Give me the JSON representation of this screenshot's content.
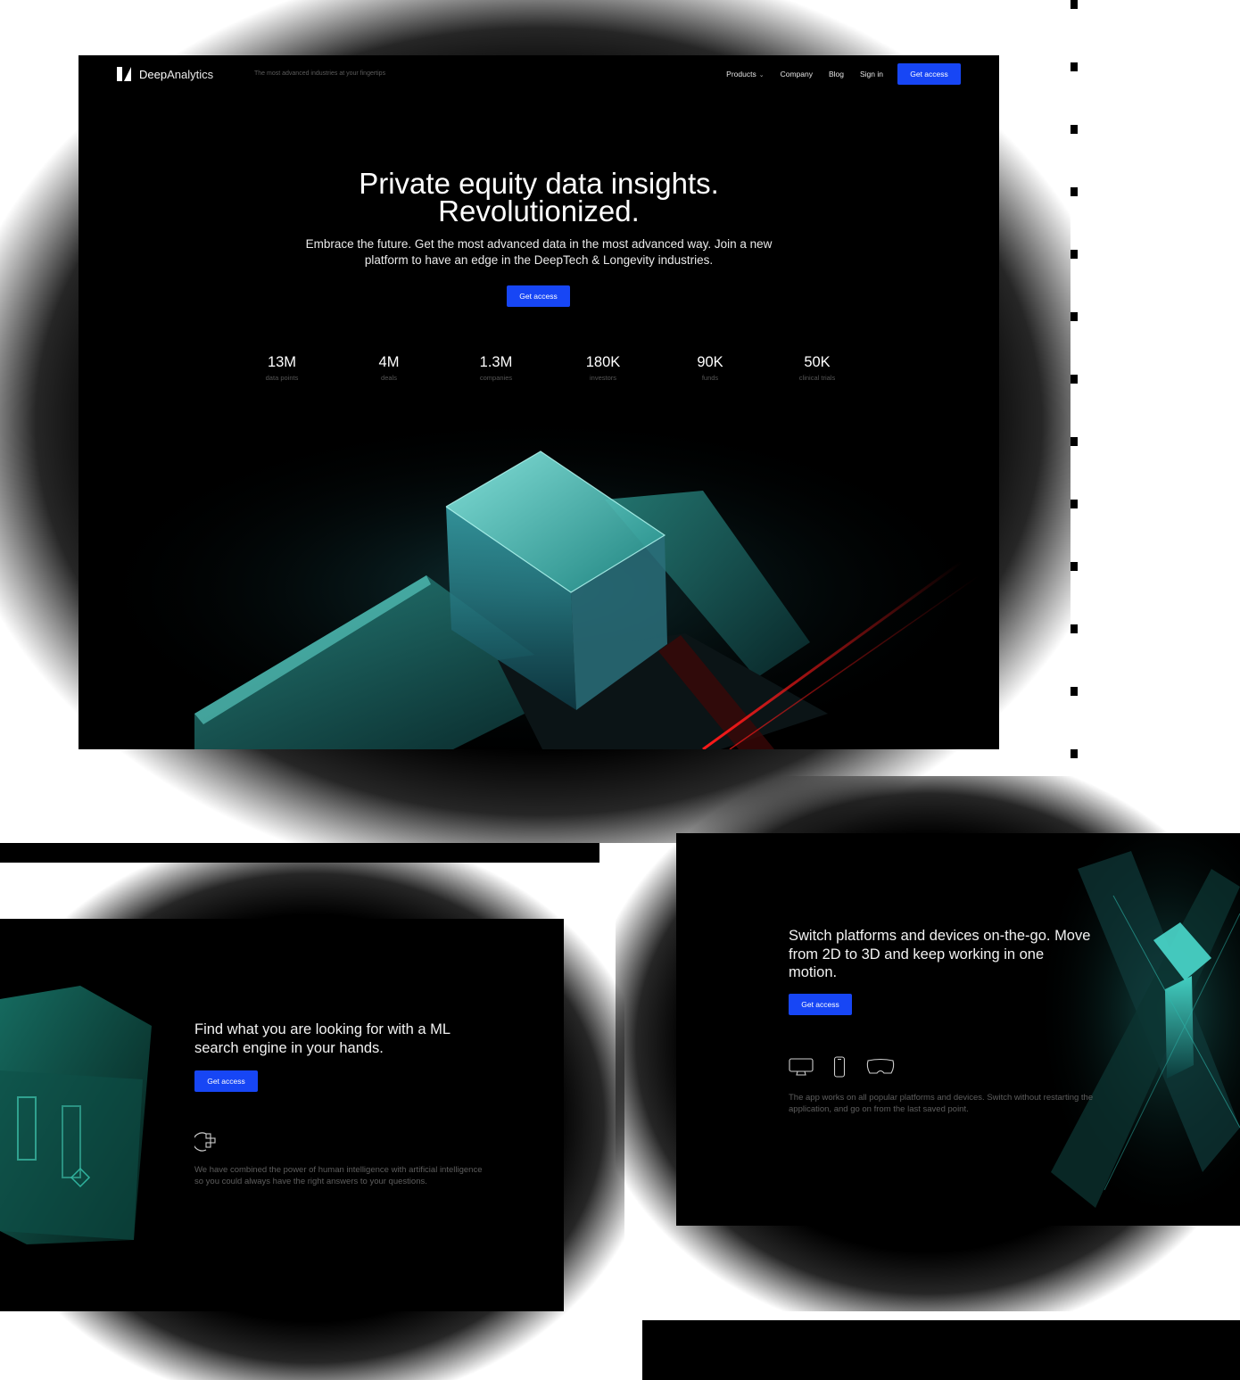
{
  "brand": {
    "name_bold": "Deep",
    "name_rest": "Analytics",
    "tagline": "The most advanced industries at your fingertips"
  },
  "nav": {
    "items": [
      "Products",
      "Company",
      "Blog",
      "Sign in"
    ],
    "cta": "Get access"
  },
  "hero": {
    "title_line1": "Private equity data insights.",
    "title_line2": "Revolutionized.",
    "subtitle": "Embrace the future. Get the most advanced data in the most advanced way. Join a new platform to have an edge in the DeepTech & Longevity industries.",
    "cta": "Get access"
  },
  "stats": [
    {
      "value": "13M",
      "label": "data points"
    },
    {
      "value": "4M",
      "label": "deals"
    },
    {
      "value": "1.3M",
      "label": "companies"
    },
    {
      "value": "180K",
      "label": "investors"
    },
    {
      "value": "90K",
      "label": "funds"
    },
    {
      "value": "50K",
      "label": "clinical trials"
    }
  ],
  "search_section": {
    "title": "Find what you are looking for with a ML search engine in your hands.",
    "cta": "Get access",
    "icon": "brain-circuit-icon",
    "description": "We have combined the power of human intelligence with artificial intelligence so you could always have the right answers to your questions."
  },
  "devices_section": {
    "title": "Switch platforms and devices on-the-go. Move from 2D to 3D and keep working in one motion.",
    "cta": "Get access",
    "icons": [
      "desktop-icon",
      "phone-icon",
      "vr-headset-icon"
    ],
    "description": "The app works on all popular platforms and devices. Switch without restarting the application, and go on from the last saved point."
  },
  "colors": {
    "accent": "#1746f5",
    "teal": "#2fc7c0",
    "red": "#ff2020",
    "background": "#000000"
  }
}
